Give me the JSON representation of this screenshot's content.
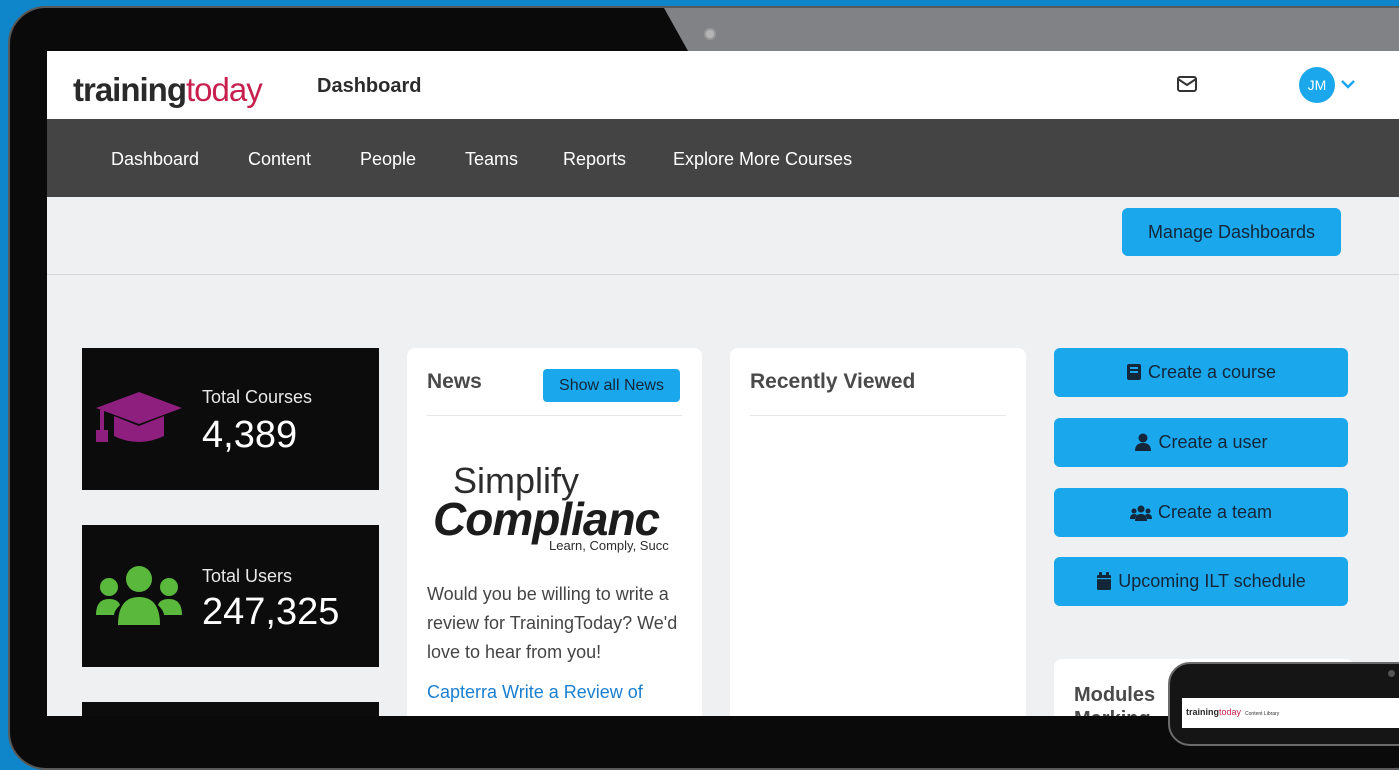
{
  "header": {
    "logo_part1": "training",
    "logo_part2": "today",
    "page_label": "Dashboard",
    "avatar_initials": "JM"
  },
  "nav": {
    "items": [
      "Dashboard",
      "Content",
      "People",
      "Teams",
      "Reports",
      "Explore More Courses"
    ]
  },
  "toolbar": {
    "manage_dashboards": "Manage Dashboards"
  },
  "stats": [
    {
      "label": "Total Courses",
      "value": "4,389",
      "icon": "graduation-cap-icon",
      "color": "#8e1f7e"
    },
    {
      "label": "Total Users",
      "value": "247,325",
      "icon": "users-icon",
      "color": "#5ab93c"
    }
  ],
  "news": {
    "title": "News",
    "show_all": "Show all News",
    "logo_line1": "Simplify",
    "logo_line2": "Complianc",
    "logo_tagline": "Learn, Comply, Succ",
    "body": "Would you be willing to write a review for TrainingToday? We'd love to hear from you!",
    "link": "Capterra Write a Review of"
  },
  "recent": {
    "title": "Recently Viewed"
  },
  "actions": [
    {
      "label": "Create a course",
      "icon": "book-icon"
    },
    {
      "label": "Create a user",
      "icon": "user-icon"
    },
    {
      "label": "Create a team",
      "icon": "team-icon"
    },
    {
      "label": "Upcoming ILT schedule",
      "icon": "calendar-icon"
    }
  ],
  "modules": {
    "title": "Modules Marking"
  },
  "tablet": {
    "logo_part1": "training",
    "logo_part2": "today",
    "page_label": "Content Library"
  },
  "colors": {
    "accent": "#1aa7ec",
    "brand_red": "#c8204e",
    "nav_bg": "#444444"
  }
}
